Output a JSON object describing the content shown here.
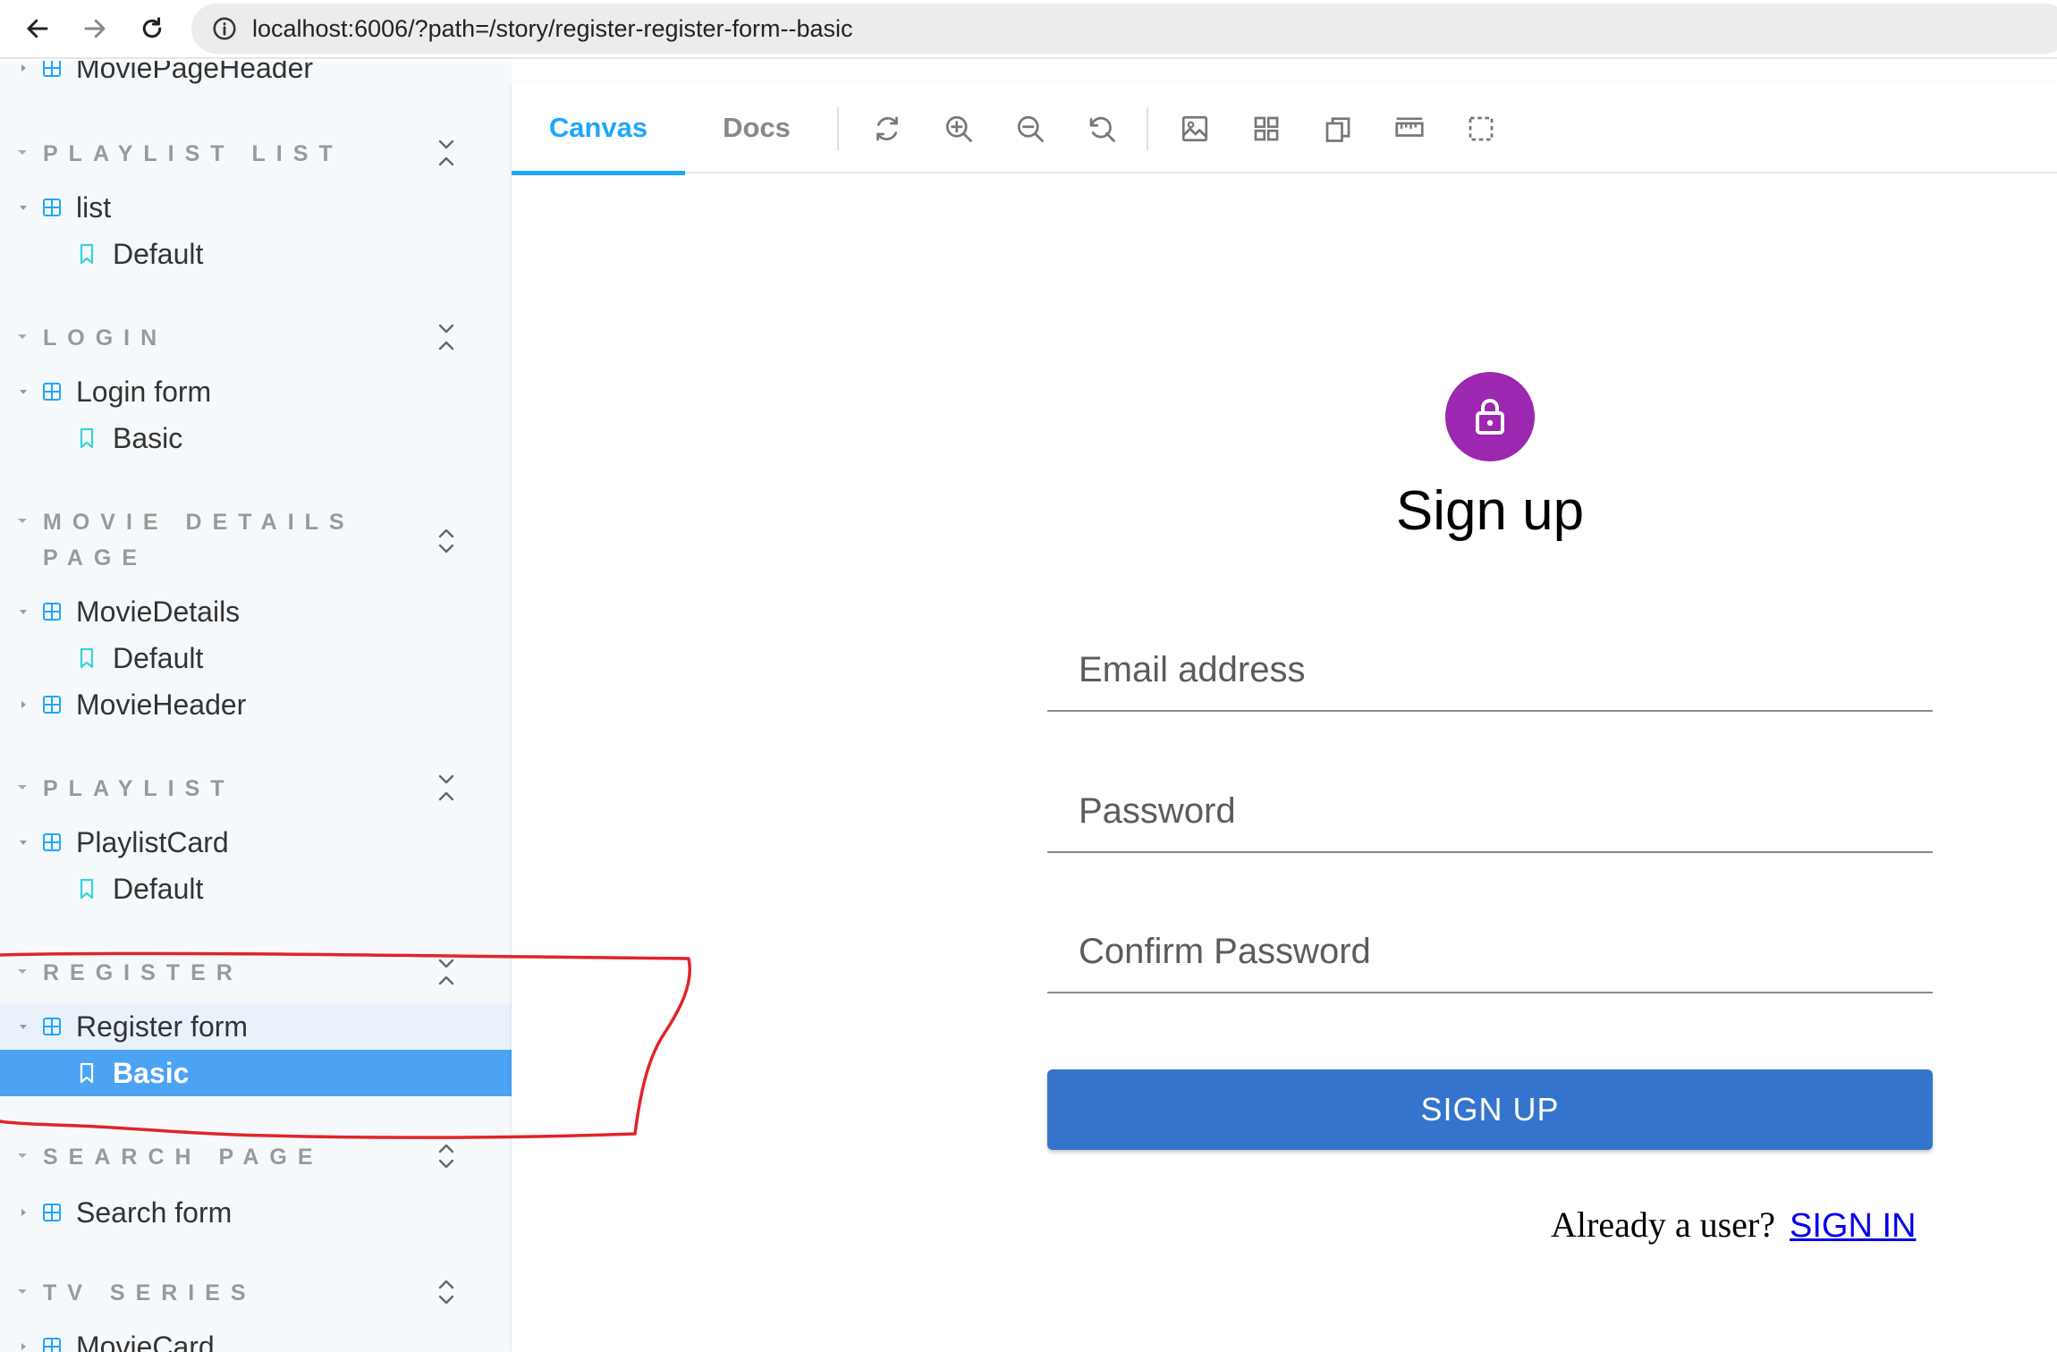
{
  "browser": {
    "url": "localhost:6006/?path=/story/register-register-form--basic"
  },
  "sidebar": {
    "top_item": "MoviePageHeader",
    "groups": [
      {
        "title": "PLAYLIST LIST",
        "items": [
          {
            "component": "list",
            "stories": [
              "Default"
            ]
          }
        ]
      },
      {
        "title": "LOGIN",
        "items": [
          {
            "component": "Login form",
            "stories": [
              "Basic"
            ]
          }
        ]
      },
      {
        "title": "MOVIE DETAILS PAGE",
        "items": [
          {
            "component": "MovieDetails",
            "stories": [
              "Default"
            ]
          },
          {
            "component": "MovieHeader",
            "stories": []
          }
        ]
      },
      {
        "title": "PLAYLIST",
        "items": [
          {
            "component": "PlaylistCard",
            "stories": [
              "Default"
            ]
          }
        ]
      },
      {
        "title": "REGISTER",
        "items": [
          {
            "component": "Register form",
            "stories": [
              "Basic"
            ]
          }
        ]
      },
      {
        "title": "SEARCH PAGE",
        "items": [
          {
            "component": "Search form",
            "stories": []
          }
        ]
      },
      {
        "title": "TV SERIES",
        "items": [
          {
            "component": "MovieCard",
            "stories": []
          }
        ]
      }
    ],
    "selected_story": "Basic"
  },
  "toolbar": {
    "tabs": [
      "Canvas",
      "Docs"
    ],
    "active_tab": "Canvas",
    "tools": [
      "refresh-icon",
      "zoom-in-icon",
      "zoom-out-icon",
      "zoom-reset-icon",
      "background-icon",
      "grid-icon",
      "viewport-icon",
      "measure-icon",
      "outline-icon"
    ]
  },
  "form": {
    "title": "Sign up",
    "email_placeholder": "Email address",
    "password_placeholder": "Password",
    "confirm_placeholder": "Confirm Password",
    "submit_label": "SIGN UP",
    "signin_prompt": "Already a user?",
    "signin_link": "SIGN IN"
  },
  "colors": {
    "accent": "#1ea7fd",
    "selected_bg": "#4ca3f3",
    "avatar": "#9c27b0",
    "button": "#3474cc",
    "annotation": "#e0242a"
  }
}
